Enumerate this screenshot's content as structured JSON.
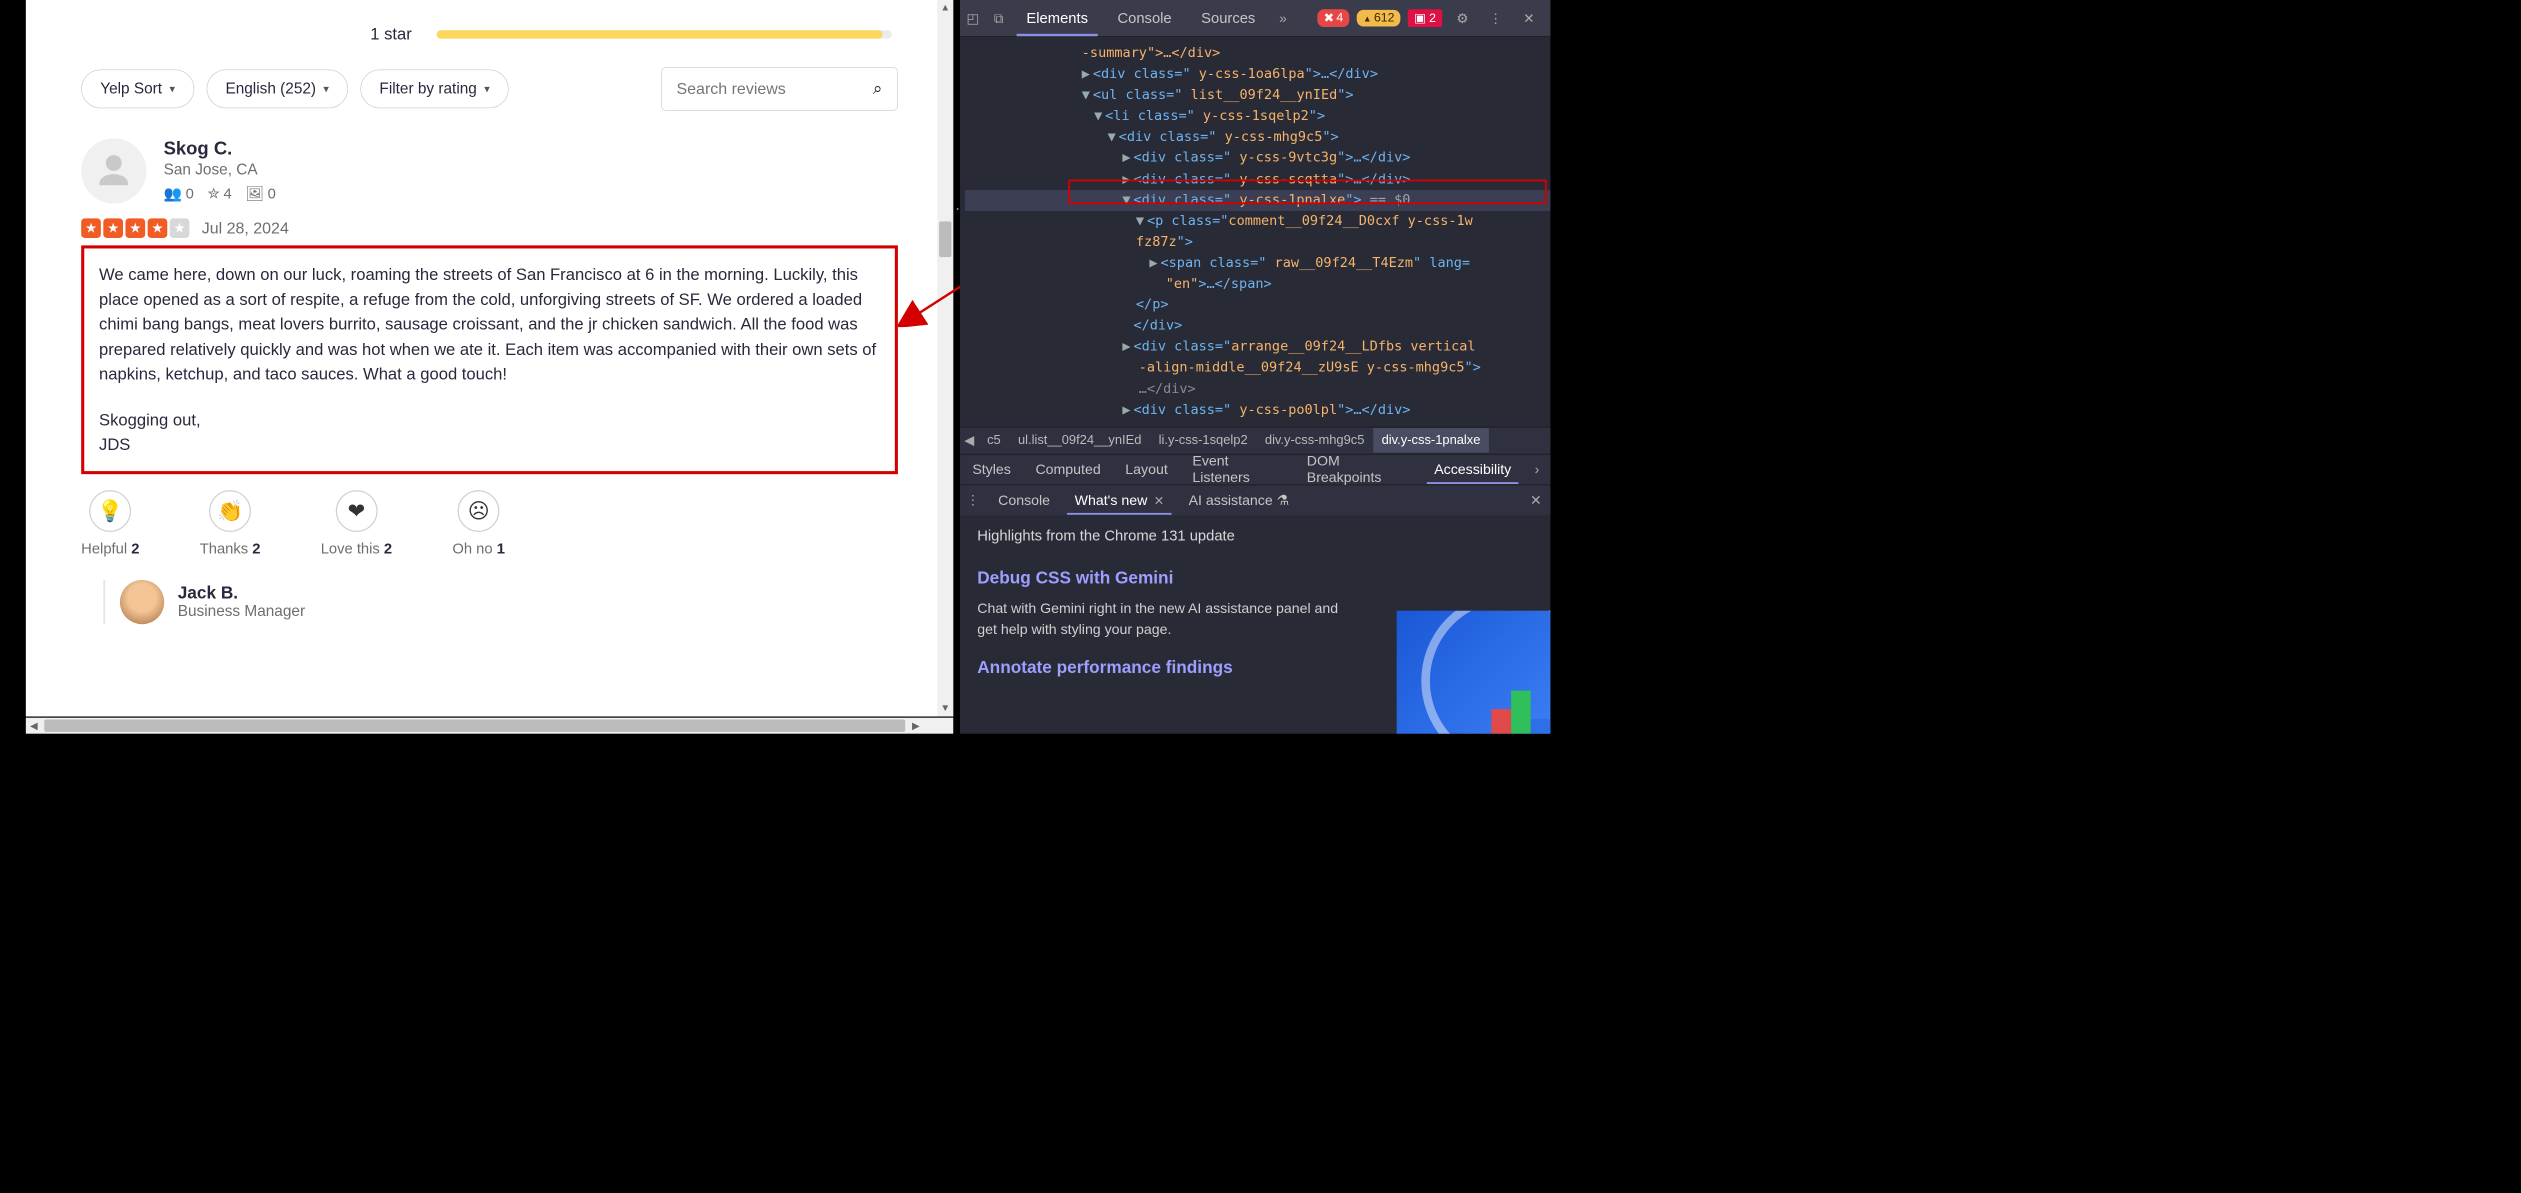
{
  "rating": {
    "label": "1 star"
  },
  "filters": {
    "sort": "Yelp Sort",
    "language": "English (252)",
    "rating": "Filter by rating"
  },
  "search": {
    "placeholder": "Search reviews"
  },
  "review": {
    "user": {
      "name": "Skog C.",
      "location": "San Jose, CA",
      "friends": "0",
      "reviews": "4",
      "photos": "0"
    },
    "date": "Jul 28, 2024",
    "body_p1": "We came here, down on our luck, roaming the streets of San Francisco at 6 in the morning. Luckily, this place opened as a sort of respite, a refuge from the cold, unforgiving streets of SF. We ordered a loaded chimi bang bangs, meat lovers burrito, sausage croissant, and the jr chicken sandwich. All the food was prepared relatively quickly and was hot when we ate it. Each item was accompanied with their own sets of napkins, ketchup, and taco sauces. What a good touch!",
    "body_p2": "Skogging out,\nJDS"
  },
  "actions": {
    "helpful": {
      "label": "Helpful",
      "count": "2"
    },
    "thanks": {
      "label": "Thanks",
      "count": "2"
    },
    "love": {
      "label": "Love this",
      "count": "2"
    },
    "ohno": {
      "label": "Oh no",
      "count": "1"
    }
  },
  "reply": {
    "name": "Jack B.",
    "role": "Business Manager"
  },
  "devtools": {
    "tabs": {
      "elements": "Elements",
      "console": "Console",
      "sources": "Sources"
    },
    "errors": "4",
    "warnings": "612",
    "issues": "2",
    "breadcrumbs": [
      "c5",
      "ul.list__09f24__ynIEd",
      "li.y-css-1sqelp2",
      "div.y-css-mhg9c5",
      "div.y-css-1pnalxe"
    ],
    "styles_tabs": [
      "Styles",
      "Computed",
      "Layout",
      "Event Listeners",
      "DOM Breakpoints",
      "Accessibility"
    ],
    "drawer": {
      "console": "Console",
      "whatsnew": "What's new",
      "ai": "AI assistance"
    },
    "whatsnew": {
      "headline": "Highlights from the Chrome 131 update",
      "h1": "Debug CSS with Gemini",
      "p1": "Chat with Gemini right in the new AI assistance panel and get help with styling your page.",
      "h2": "Annotate performance findings"
    },
    "dom": {
      "l1": "-summary\">…</div>",
      "l2a": "<div class=\"",
      "l2b": " y-css-1oa6lpa",
      "l2c": "\">…</div>",
      "l3a": "<ul class=\"",
      "l3b": " list__09f24__ynIEd",
      "l3c": "\">",
      "l4a": "<li class=\"",
      "l4b": " y-css-1sqelp2",
      "l4c": "\">",
      "l5a": "<div class=\"",
      "l5b": " y-css-mhg9c5",
      "l5c": "\">",
      "l6a": "<div class=\"",
      "l6b": " y-css-9vtc3g",
      "l6c": "\">…</div>",
      "l7a": "<div class=\"",
      "l7b": " y-css-scqtta",
      "l7c": "\">…</div>",
      "l8a": "<div class=\"",
      "l8b": " y-css-1pnalxe",
      "l8c": "\">",
      "l8d": " == $0",
      "l9a": "<p class=\"",
      "l9b": "comment__09f24__D0cxf y-css-1w",
      "l9c": "fz87z",
      "l9d": "\">",
      "l10a": "<span class=\"",
      "l10b": " raw__09f24__T4Ezm",
      "l10c": "\" lang=",
      "l10d": "\"en\"",
      "l10e": ">…</span>",
      "l11": "</p>",
      "l12": "</div>",
      "l13a": "<div class=\"",
      "l13b": "arrange__09f24__LDfbs vertical",
      "l13c": "-align-middle__09f24__zU9sE y-css-mhg9c5",
      "l13d": "\">",
      "l13e": "…</div>",
      "l14a": "<div class=\"",
      "l14b": " y-css-po0lpl",
      "l14c": "\">…</div>"
    }
  }
}
